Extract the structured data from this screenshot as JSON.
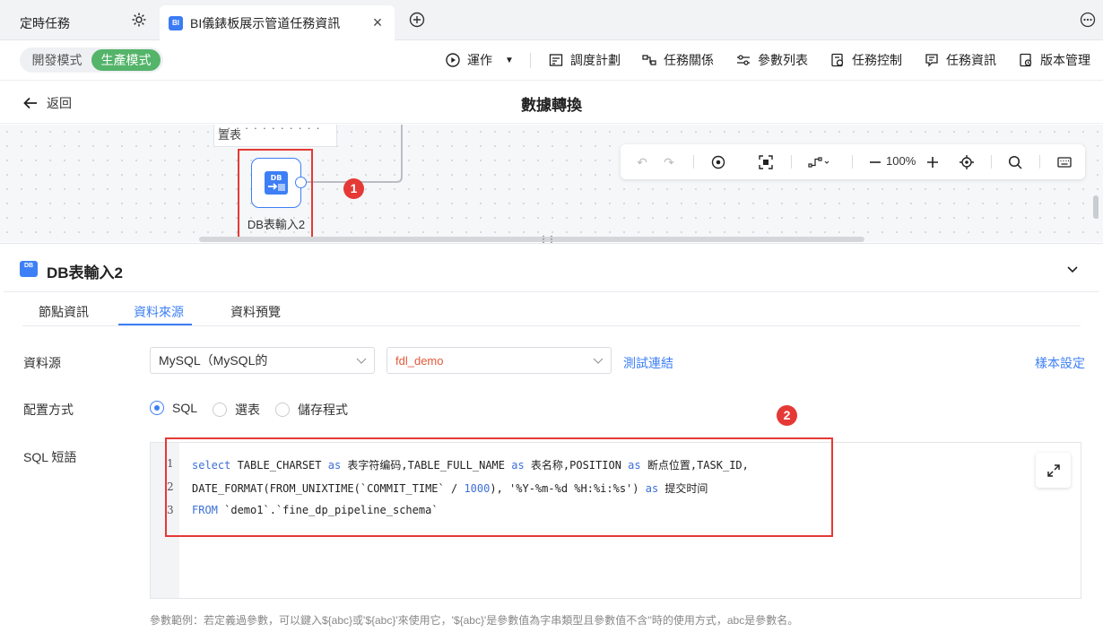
{
  "tabs": {
    "tab1_label": "定時任務",
    "tab2_label": "BI儀錶板展示管道任務資訊",
    "tab2_icon_text": "BI"
  },
  "toolbar": {
    "mode_dev": "開發模式",
    "mode_prod": "生產模式",
    "run": "運作",
    "schedule": "調度計劃",
    "relations": "任務關係",
    "params": "參數列表",
    "control": "任務控制",
    "info": "任務資訊",
    "version": "版本管理"
  },
  "header": {
    "back": "返回",
    "title": "數據轉換"
  },
  "canvas": {
    "prev_node_text": "置表",
    "node_label": "DB表輸入2",
    "node_icon_text": "DB",
    "badge1": "1",
    "zoom": "100%"
  },
  "panel": {
    "icon_text": "DB",
    "title": "DB表輸入2",
    "tabs": [
      "節點資訊",
      "資料來源",
      "資料預覽"
    ],
    "active_tab": "資料來源",
    "datasource_label": "資料源",
    "datasource_type": "MySQL（MySQL的",
    "datasource_db": "fdl_demo",
    "test_link": "測試連結",
    "sample_link": "樣本設定",
    "config_label": "配置方式",
    "config_options": [
      "SQL",
      "選表",
      "儲存程式"
    ],
    "config_selected": "SQL",
    "sql_label": "SQL 短語",
    "badge2": "2",
    "hint": "參數範例：若定義過參數，可以鍵入${abc}或'${abc}'來使用它，'${abc}'是參數值為字串類型且參數值不含''時的使用方式，abc是參數名。"
  },
  "sql": {
    "line_numbers": [
      "1",
      "2",
      "3"
    ],
    "l1_kw1": "select",
    "l1_a": " TABLE_CHARSET ",
    "l1_kw2": "as",
    "l1_b": " 表字符编码,TABLE_FULL_NAME ",
    "l1_kw3": "as",
    "l1_c": " 表名称,POSITION ",
    "l1_kw4": "as",
    "l1_d": " 断点位置,TASK_ID,",
    "l2_a": "DATE_FORMAT(FROM_UNIXTIME(`COMMIT_TIME` / ",
    "l2_num": "1000",
    "l2_b": "), '%Y-%m-%d %H:%i:%s') ",
    "l2_kw": "as",
    "l2_c": " 提交时间",
    "l3_kw": "FROM",
    "l3_a": " `demo1`.`fine_dp_pipeline_schema`"
  }
}
